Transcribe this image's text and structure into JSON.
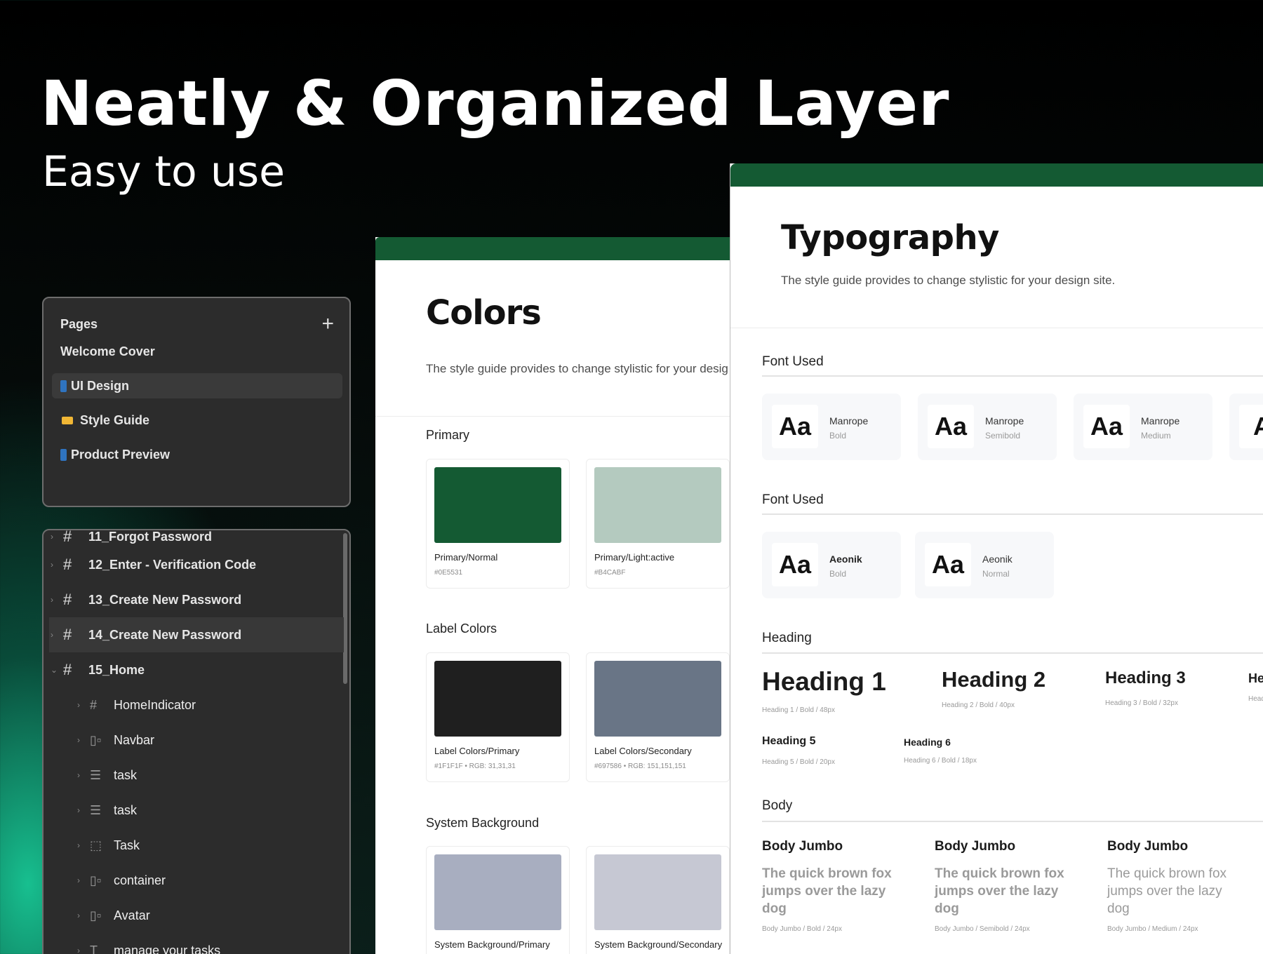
{
  "hero": {
    "title": "Neatly & Organized Layer",
    "subtitle": "Easy to use"
  },
  "pages_panel": {
    "header": "Pages",
    "add_icon": "+",
    "items": [
      {
        "label": "Welcome Cover",
        "icon": "none"
      },
      {
        "label": "UI Design",
        "icon": "phone-emoji"
      },
      {
        "label": "Style Guide",
        "icon": "folder-emoji"
      },
      {
        "label": "Product Preview",
        "icon": "phone-emoji"
      }
    ]
  },
  "layers_panel": {
    "items": [
      {
        "label": "11_Forgot Password",
        "icon": "frame-icon",
        "expanded": false
      },
      {
        "label": "12_Enter - Verification Code",
        "icon": "frame-icon",
        "expanded": false
      },
      {
        "label": "13_Create New Password",
        "icon": "frame-icon",
        "expanded": false
      },
      {
        "label": "14_Create New Password",
        "icon": "frame-icon",
        "expanded": false
      },
      {
        "label": "15_Home",
        "icon": "frame-icon",
        "expanded": true
      },
      {
        "label": "HomeIndicator",
        "icon": "frame-icon"
      },
      {
        "label": "Navbar",
        "icon": "auto-layout-icon"
      },
      {
        "label": "task",
        "icon": "vertical-layout-icon"
      },
      {
        "label": "task",
        "icon": "vertical-layout-icon"
      },
      {
        "label": "Task",
        "icon": "group-icon"
      },
      {
        "label": "container",
        "icon": "auto-layout-icon"
      },
      {
        "label": "Avatar",
        "icon": "auto-layout-icon"
      },
      {
        "label": "manage your tasks",
        "icon": "text-icon"
      }
    ]
  },
  "colors": {
    "title": "Colors",
    "description": "The style guide provides to change stylistic for your desig",
    "sections": [
      {
        "label": "Primary",
        "swatches": [
          {
            "name": "Primary/Normal",
            "code": "#0E5531",
            "color": "#145a33"
          },
          {
            "name": "Primary/Light:active",
            "code": "#B4CABF",
            "color": "#b4cabf"
          }
        ]
      },
      {
        "label": "Label Colors",
        "swatches": [
          {
            "name": "Label Colors/Primary",
            "code": "#1F1F1F  •  RGB: 31,31,31",
            "color": "#1f1f1f"
          },
          {
            "name": "Label Colors/Secondary",
            "code": "#697586  •  RGB: 151,151,151",
            "color": "#697586"
          }
        ]
      },
      {
        "label": "System Background",
        "swatches": [
          {
            "name": "System Background/Primary",
            "code": "",
            "color": "#a8aec0"
          },
          {
            "name": "System Background/Secondary",
            "code": "",
            "color": "#c6c8d3"
          }
        ]
      }
    ]
  },
  "typography": {
    "title": "Typography",
    "description": "The style guide provides to change stylistic for your design site.",
    "font_used_label_1": "Font Used",
    "fonts_1": [
      {
        "aa": "Aa",
        "name": "Manrope",
        "weight": "Bold"
      },
      {
        "aa": "Aa",
        "name": "Manrope",
        "weight": "Semibold"
      },
      {
        "aa": "Aa",
        "name": "Manrope",
        "weight": "Medium"
      },
      {
        "aa": "A"
      }
    ],
    "font_used_label_2": "Font Used",
    "fonts_2": [
      {
        "aa": "Aa",
        "name": "Aeonik",
        "weight": "Bold"
      },
      {
        "aa": "Aa",
        "name": "Aeonik",
        "weight": "Normal"
      }
    ],
    "heading_label": "Heading",
    "headings": [
      {
        "text": "Heading 1",
        "meta": "Heading 1 / Bold / 48px"
      },
      {
        "text": "Heading 2",
        "meta": "Heading 2 / Bold / 40px"
      },
      {
        "text": "Heading 3",
        "meta": "Heading 3 / Bold / 32px"
      },
      {
        "text": "He",
        "meta": "Head"
      },
      {
        "text": "Heading 5",
        "meta": "Heading 5 / Bold / 20px"
      },
      {
        "text": "Heading 6",
        "meta": "Heading 6 / Bold / 18px"
      }
    ],
    "body_label": "Body",
    "bodies": [
      {
        "title": "Body Jumbo",
        "sample": "The quick brown fox jumps over the lazy dog",
        "meta": "Body Jumbo / Bold / 24px"
      },
      {
        "title": "Body Jumbo",
        "sample": "The quick brown fox jumps over the lazy dog",
        "meta": "Body Jumbo / Semibold / 24px"
      },
      {
        "title": "Body Jumbo",
        "sample": "The quick brown fox jumps over the lazy dog",
        "meta": "Body Jumbo / Medium / 24px"
      }
    ]
  }
}
